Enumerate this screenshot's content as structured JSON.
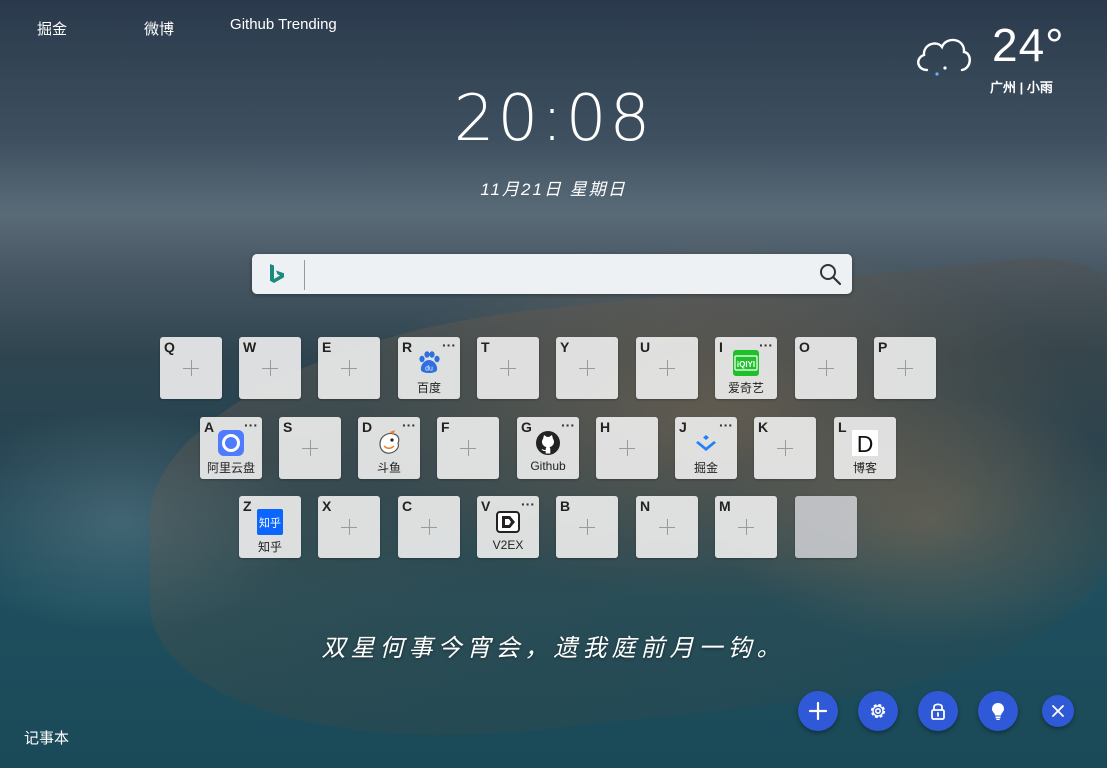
{
  "nav": {
    "links": [
      {
        "label": "掘金"
      },
      {
        "label": "微博"
      },
      {
        "label": "Github Trending"
      }
    ]
  },
  "weather": {
    "temperature": "24°",
    "location": "广州 | 小雨",
    "icon": "cloud-rain-icon"
  },
  "clock": {
    "time": "20:08",
    "date": "11月21日 星期日"
  },
  "search": {
    "engine_icon": "bing-icon",
    "value": "",
    "placeholder": ""
  },
  "tiles": {
    "row1": [
      {
        "key": "Q",
        "label": ""
      },
      {
        "key": "W",
        "label": ""
      },
      {
        "key": "E",
        "label": ""
      },
      {
        "key": "R",
        "label": "百度",
        "icon": "baidu-icon"
      },
      {
        "key": "T",
        "label": ""
      },
      {
        "key": "Y",
        "label": ""
      },
      {
        "key": "U",
        "label": ""
      },
      {
        "key": "I",
        "label": "爱奇艺",
        "icon": "iqiyi-icon"
      },
      {
        "key": "O",
        "label": ""
      },
      {
        "key": "P",
        "label": ""
      }
    ],
    "row2": [
      {
        "key": "A",
        "label": "阿里云盘",
        "icon": "aliyun-drive-icon"
      },
      {
        "key": "S",
        "label": ""
      },
      {
        "key": "D",
        "label": "斗鱼",
        "icon": "douyu-icon"
      },
      {
        "key": "F",
        "label": ""
      },
      {
        "key": "G",
        "label": "Github",
        "icon": "github-icon"
      },
      {
        "key": "H",
        "label": ""
      },
      {
        "key": "J",
        "label": "掘金",
        "icon": "juejin-icon"
      },
      {
        "key": "K",
        "label": ""
      },
      {
        "key": "L",
        "label": "博客",
        "icon": "blog-d-icon"
      }
    ],
    "row3": [
      {
        "key": "Z",
        "label": "知乎",
        "icon": "zhihu-icon"
      },
      {
        "key": "X",
        "label": ""
      },
      {
        "key": "C",
        "label": ""
      },
      {
        "key": "V",
        "label": "V2EX",
        "icon": "v2ex-icon"
      },
      {
        "key": "B",
        "label": ""
      },
      {
        "key": "N",
        "label": ""
      },
      {
        "key": "M",
        "label": ""
      },
      {
        "key": "",
        "label": ""
      }
    ],
    "more_glyph": "···",
    "zhihu_logo_text": "知乎",
    "blog_logo_text": "D",
    "baidu_logo_text": "du",
    "iqiyi_logo_text": "iQIYI"
  },
  "poem": "双星何事今宵会，遗我庭前月一钩。",
  "notepad": {
    "label": "记事本"
  },
  "actions": [
    {
      "name": "add",
      "icon": "plus-icon"
    },
    {
      "name": "settings",
      "icon": "gear-icon"
    },
    {
      "name": "lock",
      "icon": "lock-icon"
    },
    {
      "name": "tips",
      "icon": "lightbulb-icon"
    },
    {
      "name": "close",
      "icon": "close-icon"
    }
  ],
  "colors": {
    "accent": "#2f59d6",
    "tile_bg": "#ebebeb"
  }
}
